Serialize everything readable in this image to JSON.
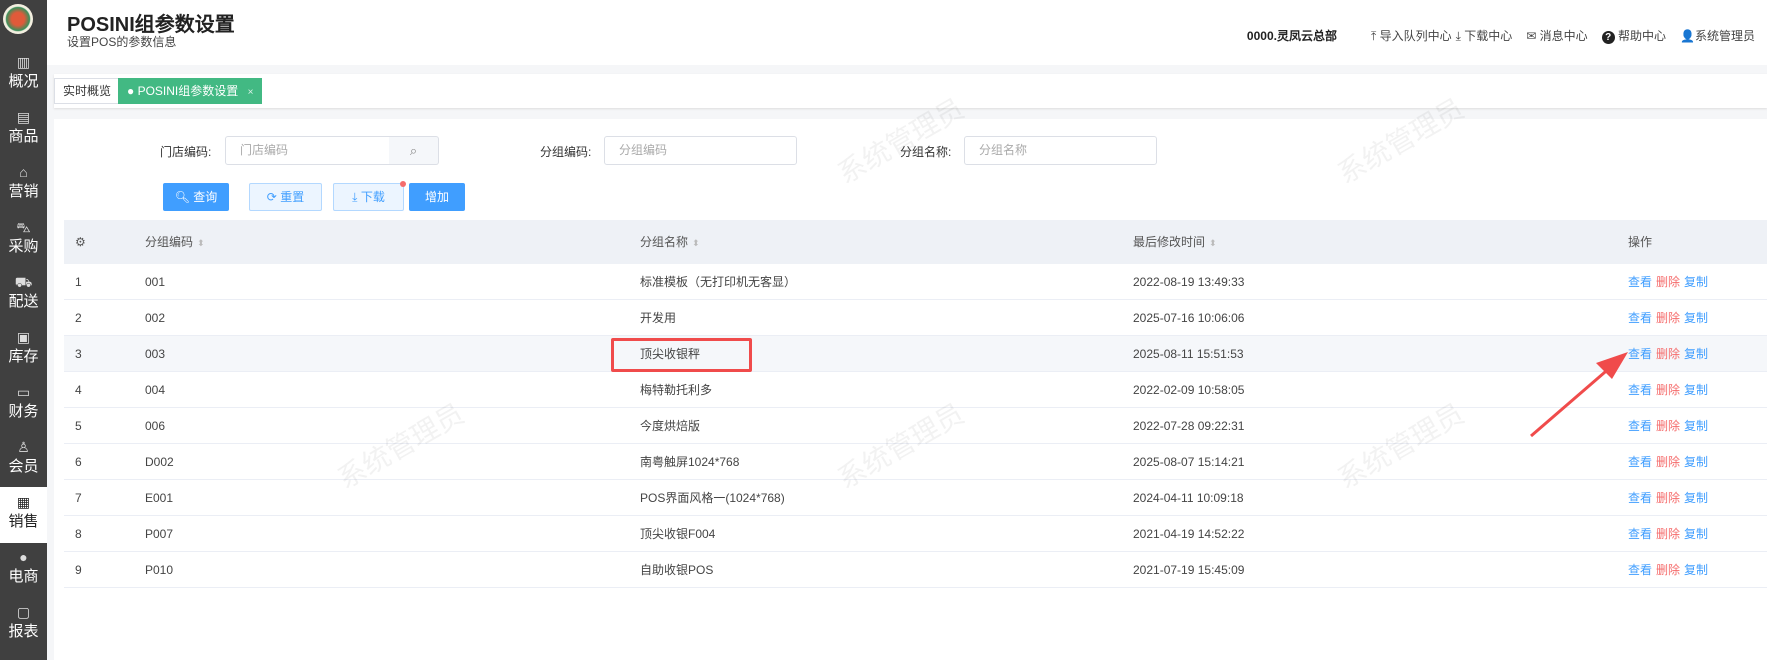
{
  "sidebar": {
    "items": [
      {
        "label": "概况",
        "icon": "building-icon"
      },
      {
        "label": "商品",
        "icon": "document-icon"
      },
      {
        "label": "营销",
        "icon": "tag-icon"
      },
      {
        "label": "采购",
        "icon": "cart-icon"
      },
      {
        "label": "配送",
        "icon": "truck-icon"
      },
      {
        "label": "库存",
        "icon": "box-icon"
      },
      {
        "label": "财务",
        "icon": "money-icon"
      },
      {
        "label": "会员",
        "icon": "user-icon"
      },
      {
        "label": "销售",
        "icon": "cash-register-icon"
      },
      {
        "label": "电商",
        "icon": "person-icon"
      },
      {
        "label": "报表",
        "icon": "chart-board-icon"
      }
    ],
    "active": "销售"
  },
  "header": {
    "title": "POSINI组参数设置",
    "subtitle": "设置POS的参数信息",
    "org": "0000.灵凤云总部",
    "import_queue": "导入队列中心",
    "download_center": "下载中心",
    "messages": "消息中心",
    "help": "帮助中心",
    "user": "系统管理员"
  },
  "tabs": [
    {
      "label": "实时概览"
    },
    {
      "label": "POSINI组参数设置",
      "close": "×"
    }
  ],
  "filters": {
    "store_code_label": "门店编码:",
    "store_code_placeholder": "门店编码",
    "group_code_label": "分组编码:",
    "group_code_placeholder": "分组编码",
    "group_name_label": "分组名称:",
    "group_name_placeholder": "分组名称"
  },
  "buttons": {
    "query": "查询",
    "reset": "重置",
    "download": "下载",
    "add": "增加"
  },
  "table": {
    "columns": [
      "分组编码",
      "分组名称",
      "最后修改时间",
      "操作"
    ],
    "rows": [
      {
        "no": "1",
        "code": "001",
        "name": "标准模板（无打印机无客显）",
        "time": "2022-08-19 13:49:33"
      },
      {
        "no": "2",
        "code": "002",
        "name": "开发用",
        "time": "2025-07-16 10:06:06"
      },
      {
        "no": "3",
        "code": "003",
        "name": "顶尖收银秤",
        "time": "2025-08-11 15:51:53"
      },
      {
        "no": "4",
        "code": "004",
        "name": "梅特勒托利多",
        "time": "2022-02-09 10:58:05"
      },
      {
        "no": "5",
        "code": "006",
        "name": "今度烘焙版",
        "time": "2022-07-28 09:22:31"
      },
      {
        "no": "6",
        "code": "D002",
        "name": "南粤触屏1024*768",
        "time": "2025-08-07 15:14:21"
      },
      {
        "no": "7",
        "code": "E001",
        "name": "POS界面风格一(1024*768)",
        "time": "2024-04-11 10:09:18"
      },
      {
        "no": "8",
        "code": "P007",
        "name": "顶尖收银F004",
        "time": "2021-04-19 14:52:22"
      },
      {
        "no": "9",
        "code": "P010",
        "name": "自助收银POS",
        "time": "2021-07-19 15:45:09"
      }
    ],
    "actions": {
      "view": "查看",
      "delete": "删除",
      "copy": "复制"
    }
  },
  "watermark": "系统管理员",
  "colors": {
    "primary": "#409eff",
    "danger": "#f56c6c",
    "tab_active": "#42b983",
    "annotation": "#f04b4b"
  }
}
